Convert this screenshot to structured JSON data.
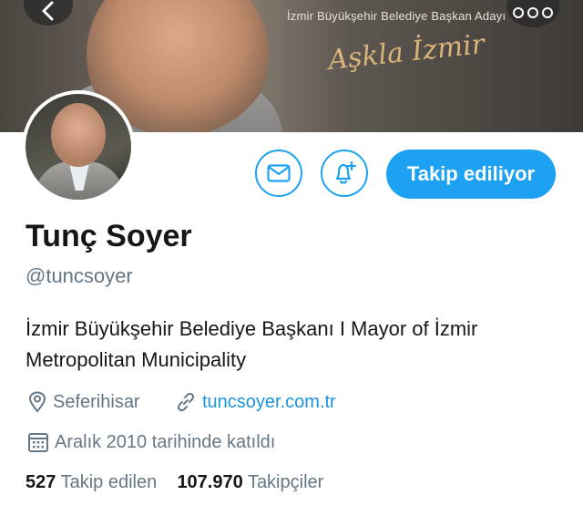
{
  "banner": {
    "subtitle": "İzmir Büyükşehir Belediye Başkan Adayı",
    "signature": "Aşkla İzmir"
  },
  "profile": {
    "name": "Tunç Soyer",
    "handle": "@tuncsoyer",
    "bio": "İzmir Büyükşehir Belediye Başkanı I Mayor of İzmir Metropolitan Municipality",
    "location": "Seferihisar",
    "website": "tuncsoyer.com.tr",
    "joined": "Aralık 2010 tarihinde katıldı"
  },
  "actions": {
    "follow_label": "Takip ediliyor"
  },
  "stats": {
    "following_count": "527",
    "following_label": "Takip edilen",
    "followers_count": "107.970",
    "followers_label": "Takipçiler"
  },
  "colors": {
    "accent": "#1da1f2",
    "link": "#1b95e0",
    "secondary_text": "#657786"
  },
  "icons": [
    "back-arrow-icon",
    "more-icon",
    "mail-icon",
    "notification-add-icon",
    "location-pin-icon",
    "link-icon",
    "calendar-icon"
  ]
}
